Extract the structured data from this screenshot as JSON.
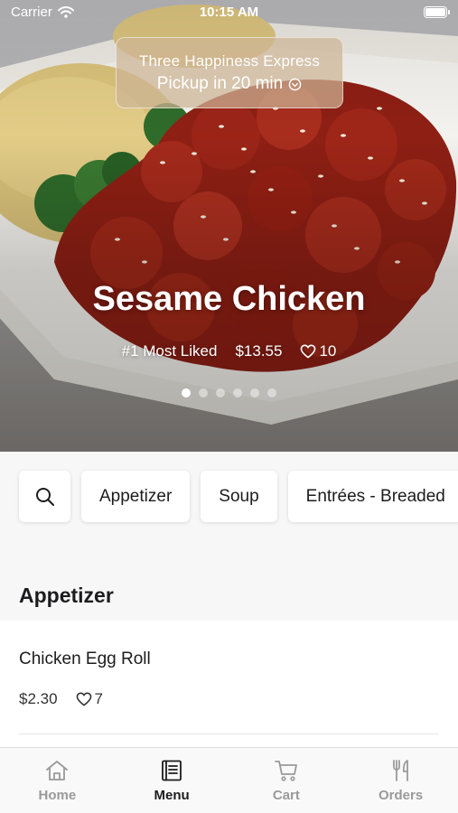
{
  "status_bar": {
    "carrier": "Carrier",
    "time": "10:15 AM"
  },
  "pickup_banner": {
    "store_name": "Three Happiness Express",
    "eta": "Pickup in 20 min"
  },
  "featured": {
    "title": "Sesame Chicken",
    "badge": "#1 Most Liked",
    "price": "$13.55",
    "likes": "10",
    "carousel_total": 6,
    "carousel_active": 0
  },
  "categories": {
    "search_icon": "search-icon",
    "items": [
      "Appetizer",
      "Soup",
      "Entrées - Breaded"
    ]
  },
  "section": {
    "title": "Appetizer"
  },
  "menu_item": {
    "name": "Chicken Egg Roll",
    "price": "$2.30",
    "likes": "7"
  },
  "tabbar": {
    "items": [
      {
        "label": "Home",
        "icon": "home-icon"
      },
      {
        "label": "Menu",
        "icon": "menu-book-icon"
      },
      {
        "label": "Cart",
        "icon": "cart-icon"
      },
      {
        "label": "Orders",
        "icon": "fork-knife-icon"
      }
    ],
    "active": "Menu"
  },
  "colors": {
    "accent_text": "#1c1c1e",
    "inactive_tab": "#9a9a9a",
    "sauce": "#8e1f14"
  }
}
